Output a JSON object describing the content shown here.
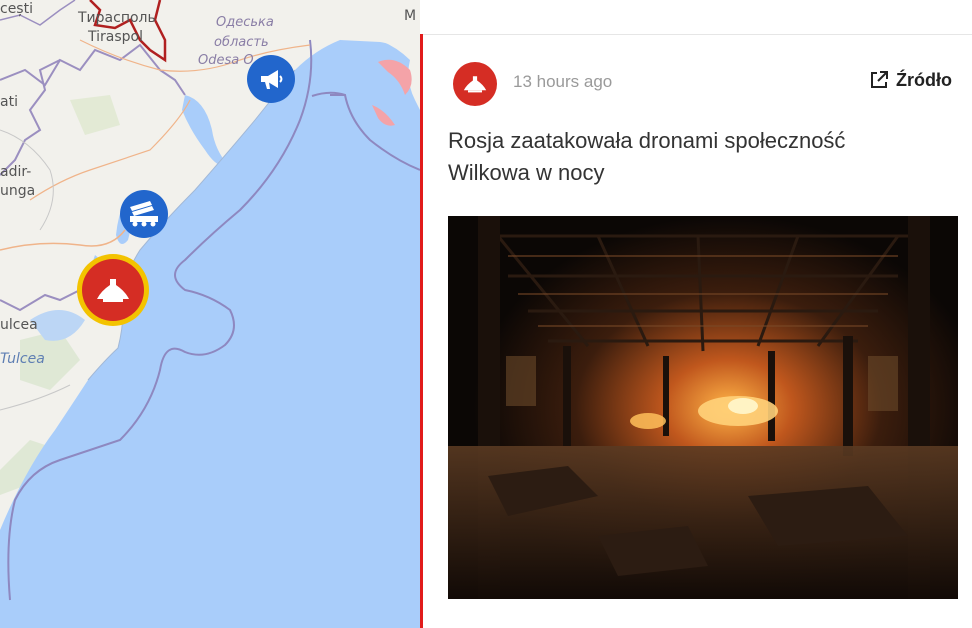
{
  "colors": {
    "sea": "#a9cdfa",
    "land": "#f2f1ec",
    "border_red": "#b02020",
    "accent_red": "#e11b1b",
    "marker_blue": "#2266cc",
    "marker_red": "#d52d24",
    "marker_ring": "#f3c300"
  },
  "map": {
    "labels": [
      {
        "id": "cesti",
        "text": "cești"
      },
      {
        "id": "tiraspol_cyr",
        "text": "Тирасполь"
      },
      {
        "id": "tiraspol_lat",
        "text": "Tiraspol"
      },
      {
        "id": "odeska",
        "text": "Одеська"
      },
      {
        "id": "oblast",
        "text": "область"
      },
      {
        "id": "odesa",
        "text": "Odesa O"
      },
      {
        "id": "m",
        "text": "M"
      },
      {
        "id": "ati",
        "text": "ati"
      },
      {
        "id": "adir",
        "text": "adir-"
      },
      {
        "id": "unga",
        "text": "unga"
      },
      {
        "id": "ulcea",
        "text": "ulcea"
      },
      {
        "id": "tulcea",
        "text": "Tulcea"
      }
    ],
    "markers": [
      {
        "id": "megaphone",
        "icon": "megaphone-icon",
        "color": "#2266cc"
      },
      {
        "id": "launcher",
        "icon": "rocket-launcher-icon",
        "color": "#2266cc"
      },
      {
        "id": "drone",
        "icon": "drone-icon",
        "color": "#d52d24",
        "selected": true
      }
    ]
  },
  "event": {
    "icon": "drone-icon",
    "time": "13 hours ago",
    "source_label": "Źródło",
    "title": "Rosja zaatakowała dronami społeczność Wilkowa w nocy",
    "image_alt": "burning-warehouse-photo"
  }
}
